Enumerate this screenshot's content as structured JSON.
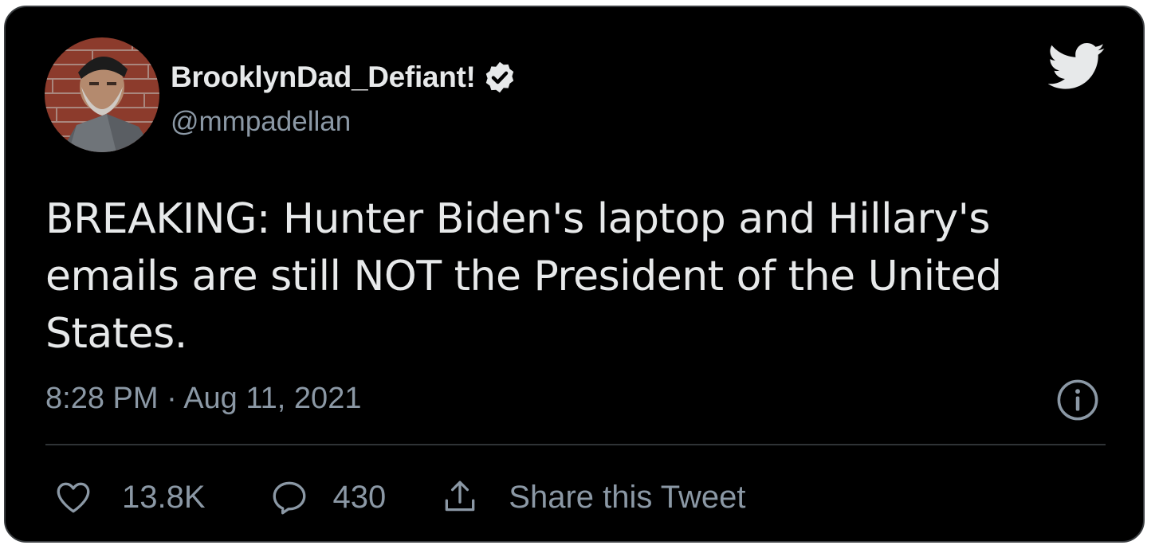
{
  "author": {
    "display_name": "BrooklynDad_Defiant!",
    "handle": "@mmpadellan",
    "verified": true,
    "avatar_icon": "user-avatar"
  },
  "tweet": {
    "text": "BREAKING: Hunter Biden's laptop and Hillary's emails are still NOT the President of the United States.",
    "timestamp": "8:28 PM · Aug 11, 2021"
  },
  "actions": {
    "like_count": "13.8K",
    "reply_count": "430",
    "share_label": "Share this Tweet"
  },
  "icons": {
    "brand": "twitter-bird-icon",
    "info": "info-icon",
    "like": "heart-icon",
    "reply": "speech-bubble-icon",
    "share": "share-upload-icon",
    "verified": "verified-badge-icon"
  },
  "colors": {
    "background": "#000000",
    "text": "#e7e9ea",
    "secondary_text": "#8b98a5",
    "divider": "#2f3336"
  }
}
